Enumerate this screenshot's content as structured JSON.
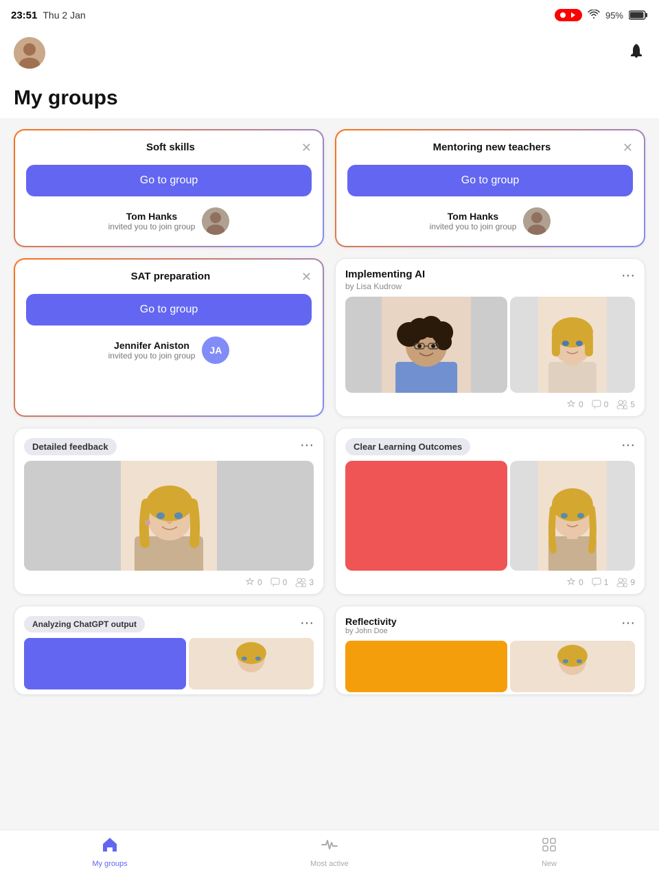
{
  "statusBar": {
    "time": "23:51",
    "date": "Thu 2 Jan",
    "battery": "95%",
    "recording": true
  },
  "header": {
    "pageTitle": "My groups"
  },
  "inviteCards": [
    {
      "id": "soft-skills",
      "title": "Soft skills",
      "buttonLabel": "Go to group",
      "inviterName": "Tom Hanks",
      "inviterDesc": "invited you to join group"
    },
    {
      "id": "mentoring-new-teachers",
      "title": "Mentoring new teachers",
      "buttonLabel": "Go to group",
      "inviterName": "Tom Hanks",
      "inviterDesc": "invited you to join group"
    },
    {
      "id": "sat-preparation",
      "title": "SAT preparation",
      "buttonLabel": "Go to group",
      "inviterName": "Jennifer Aniston",
      "inviterDesc": "invited you to join group",
      "inviterInitials": "JA"
    }
  ],
  "groupCards": [
    {
      "id": "implementing-ai",
      "title": "Implementing AI",
      "subtitle": "by Lisa Kudrow",
      "stars": "0",
      "comments": "0",
      "members": "5"
    },
    {
      "id": "detailed-feedback",
      "tag": "Detailed feedback",
      "stars": "0",
      "comments": "0",
      "members": "3"
    },
    {
      "id": "clear-learning-outcomes",
      "tag": "Clear Learning Outcomes",
      "stars": "0",
      "comments": "1",
      "members": "9"
    }
  ],
  "bottomCards": [
    {
      "id": "analyzing-chatgpt",
      "tag": "Analyzing ChatGPT output"
    },
    {
      "id": "reflectivity",
      "title": "Reflectivity",
      "subtitle": "by John Doe"
    }
  ],
  "tabBar": {
    "tabs": [
      {
        "id": "my-groups",
        "label": "My groups",
        "icon": "⊞",
        "active": true
      },
      {
        "id": "most-active",
        "label": "Most active",
        "icon": "∿",
        "active": false
      },
      {
        "id": "new",
        "label": "New",
        "icon": "⊞",
        "active": false
      }
    ]
  }
}
